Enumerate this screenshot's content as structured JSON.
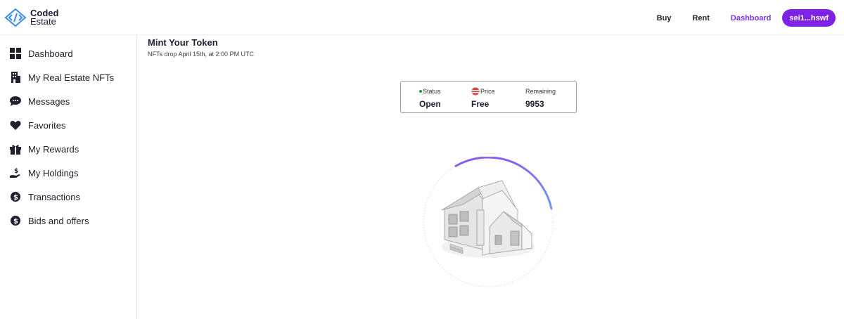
{
  "header": {
    "logo_line1": "Coded",
    "logo_line2": "Estate",
    "nav": {
      "buy": "Buy",
      "rent": "Rent",
      "dashboard": "Dashboard"
    },
    "wallet": "sei1...hswf"
  },
  "sidebar": {
    "items": [
      {
        "label": "Dashboard",
        "icon": "dashboard-grid-icon"
      },
      {
        "label": "My Real Estate NFTs",
        "icon": "building-icon"
      },
      {
        "label": "Messages",
        "icon": "chat-icon"
      },
      {
        "label": "Favorites",
        "icon": "heart-icon"
      },
      {
        "label": "My Rewards",
        "icon": "gift-icon"
      },
      {
        "label": "My Holdings",
        "icon": "hand-dollar-icon"
      },
      {
        "label": "Transactions",
        "icon": "dollar-circle-icon"
      },
      {
        "label": "Bids and offers",
        "icon": "dollar-circle-icon"
      }
    ]
  },
  "main": {
    "title": "Mint Your Token",
    "subtitle": "NFTs drop April 15th, at 2:00 PM UTC",
    "stats": {
      "status_label": "Status",
      "status_value": "Open",
      "price_label": "Price",
      "price_value": "Free",
      "remaining_label": "Remaining",
      "remaining_value": "9953"
    },
    "progress_fraction": 0.3
  },
  "colors": {
    "accent": "#7e22e8",
    "active_nav": "#7a2ee6",
    "status_dot": "#1c9a3a",
    "ring_gradient_start": "#5fd6f0",
    "ring_gradient_end": "#8a5cf0"
  }
}
